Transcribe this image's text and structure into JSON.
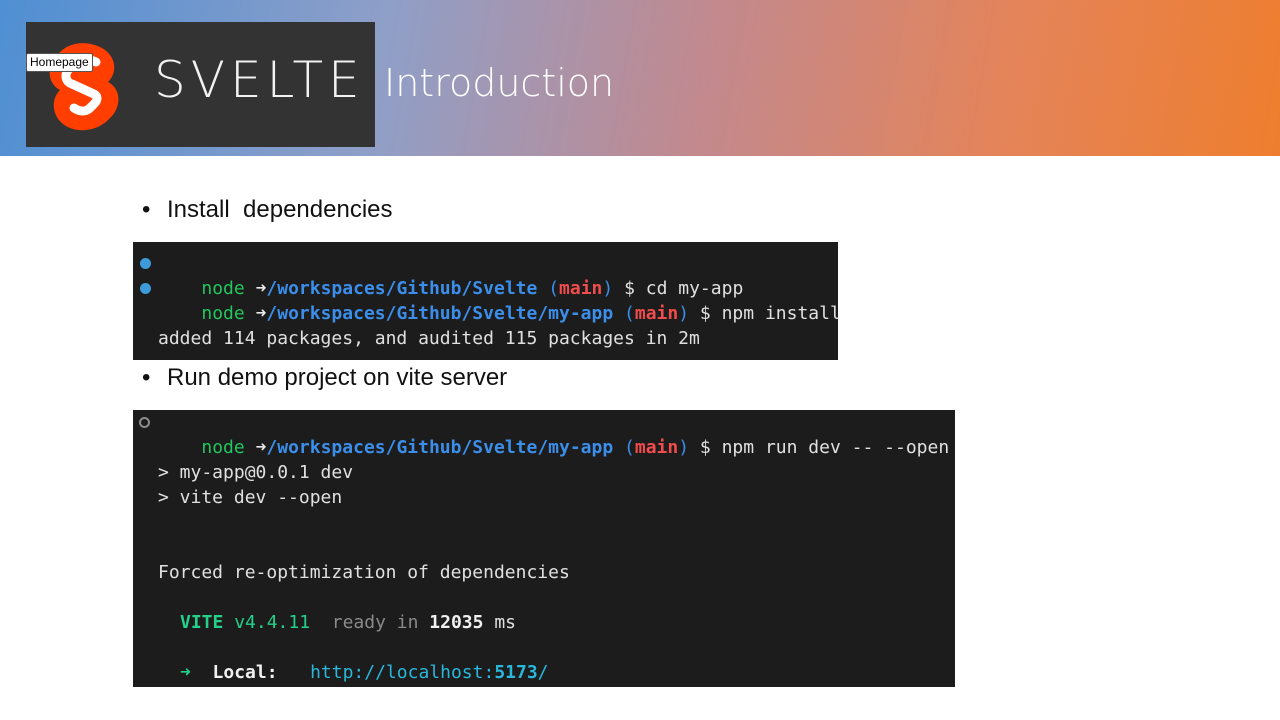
{
  "banner": {
    "logo_word": "SVELTE",
    "tooltip": "Homepage",
    "title": "Introduction",
    "logo_color": "#ff3e00"
  },
  "bullets": [
    {
      "marker": "•",
      "text": "Install  dependencies"
    },
    {
      "marker": "•",
      "text": "Run demo project on vite server"
    }
  ],
  "terminal1": {
    "lines": [
      {
        "status": "success-dot",
        "prompt_user": "node",
        "arrow": "➜",
        "path": "/workspaces/Github/Svelte",
        "branch_open": "(",
        "branch": "main",
        "branch_close": ")",
        "command": "$ cd my-app"
      },
      {
        "status": "success-dot",
        "prompt_user": "node",
        "arrow": "➜",
        "path": "/workspaces/Github/Svelte/my-app",
        "branch_open": "(",
        "branch": "main",
        "branch_close": ")",
        "command": "$ npm install"
      }
    ],
    "output": "added 114 packages, and audited 115 packages in 2m"
  },
  "terminal2": {
    "prompt": {
      "status": "running-circle",
      "prompt_user": "node",
      "arrow": "➜",
      "path": "/workspaces/Github/Svelte/my-app",
      "branch_open": "(",
      "branch": "main",
      "branch_close": ")",
      "command": "$ npm run dev -- --open"
    },
    "script_line1": "> my-app@0.0.1 dev",
    "script_line2": "> vite dev --open",
    "forced": "Forced re-optimization of dependencies",
    "vite_name": "VITE",
    "vite_version": "v4.4.11",
    "ready_text": "ready in",
    "ready_ms": "12035",
    "ready_unit": "ms",
    "local_arrow": "➜",
    "local_label": "Local:",
    "local_url_prefix": "http://localhost:",
    "local_url_port": "5173",
    "local_url_suffix": "/"
  }
}
